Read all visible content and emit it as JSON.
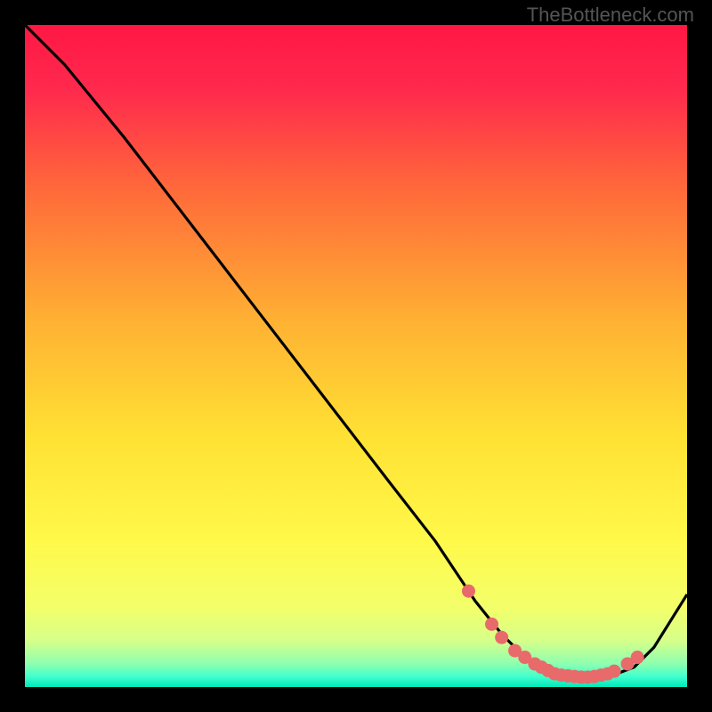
{
  "watermark": "TheBottleneck.com",
  "chart_data": {
    "type": "line",
    "title": "",
    "xlabel": "",
    "ylabel": "",
    "xlim": [
      0,
      100
    ],
    "ylim": [
      0,
      100
    ],
    "curve": {
      "name": "main-curve",
      "x": [
        0,
        6,
        15,
        25,
        35,
        45,
        55,
        62,
        68,
        72,
        76,
        80,
        84,
        88,
        92,
        95,
        100
      ],
      "y": [
        100,
        94,
        83,
        70,
        57,
        44,
        31,
        22,
        13,
        8,
        4,
        2,
        1.5,
        1.5,
        3,
        6,
        14
      ]
    },
    "highlight_points": {
      "name": "bottom-dots",
      "color": "#e86a6a",
      "x": [
        67,
        70.5,
        72,
        74,
        75.5,
        77,
        78,
        79,
        80,
        81,
        82,
        83,
        84,
        85,
        86,
        87,
        88,
        89,
        91,
        92.5
      ],
      "y": [
        14.5,
        9.5,
        7.5,
        5.5,
        4.5,
        3.5,
        3,
        2.5,
        2,
        1.8,
        1.7,
        1.6,
        1.5,
        1.5,
        1.6,
        1.8,
        2,
        2.4,
        3.5,
        4.5
      ]
    },
    "background_gradient": {
      "stops": [
        {
          "offset": 0.0,
          "color": "#ff1744"
        },
        {
          "offset": 0.1,
          "color": "#ff2a4d"
        },
        {
          "offset": 0.25,
          "color": "#ff6a3a"
        },
        {
          "offset": 0.45,
          "color": "#ffb233"
        },
        {
          "offset": 0.62,
          "color": "#ffe133"
        },
        {
          "offset": 0.78,
          "color": "#fff94a"
        },
        {
          "offset": 0.88,
          "color": "#f3ff6a"
        },
        {
          "offset": 0.93,
          "color": "#d6ff8a"
        },
        {
          "offset": 0.965,
          "color": "#8dffb0"
        },
        {
          "offset": 0.985,
          "color": "#3dffce"
        },
        {
          "offset": 1.0,
          "color": "#00e6b8"
        }
      ]
    }
  }
}
